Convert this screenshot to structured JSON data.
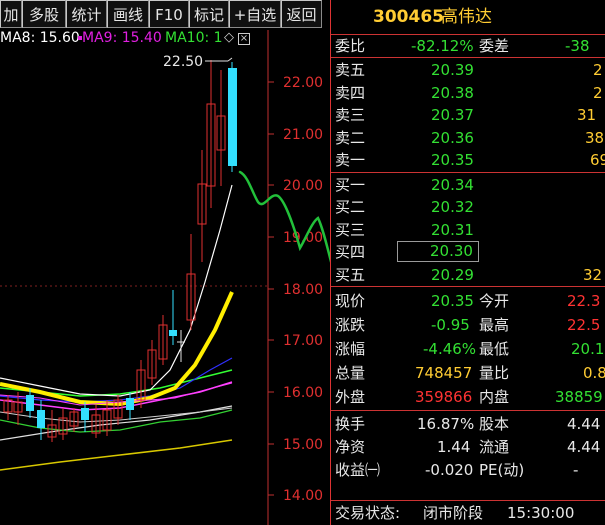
{
  "toolbar": {
    "buttons": [
      "加",
      "多股",
      "统计",
      "画线",
      "F10",
      "标记",
      "+自选",
      "返回"
    ]
  },
  "ma": {
    "ma8": "MA8: 15.60",
    "ma9": "MA9: 15.40",
    "ma10": "MA10: 1"
  },
  "chart": {
    "high_label": "22.50",
    "y_ticks": [
      "22.00",
      "21.00",
      "20.00",
      "19.00",
      "18.00",
      "17.00",
      "16.00",
      "15.00",
      "14.00"
    ]
  },
  "stock": {
    "code": "300465",
    "name": "高伟达"
  },
  "committee": {
    "ratio_label": "委比",
    "ratio_value": "-82.12%",
    "diff_label": "委差",
    "diff_value": "-38"
  },
  "asks": [
    {
      "label": "卖五",
      "price": "20.39",
      "vol": "2"
    },
    {
      "label": "卖四",
      "price": "20.38",
      "vol": "2"
    },
    {
      "label": "卖三",
      "price": "20.37",
      "vol": "31"
    },
    {
      "label": "卖二",
      "price": "20.36",
      "vol": "38"
    },
    {
      "label": "卖一",
      "price": "20.35",
      "vol": "69"
    }
  ],
  "bids": [
    {
      "label": "买一",
      "price": "20.34",
      "vol": ""
    },
    {
      "label": "买二",
      "price": "20.32",
      "vol": ""
    },
    {
      "label": "买三",
      "price": "20.31",
      "vol": ""
    },
    {
      "label": "买四",
      "price": "20.30",
      "vol": ""
    },
    {
      "label": "买五",
      "price": "20.29",
      "vol": "32"
    }
  ],
  "quote": [
    {
      "l1": "现价",
      "v1": "20.35",
      "l2": "今开",
      "v2": "22.3"
    },
    {
      "l1": "涨跌",
      "v1": "-0.95",
      "l2": "最高",
      "v2": "22.5"
    },
    {
      "l1": "涨幅",
      "v1": "-4.46%",
      "l2": "最低",
      "v2": "20.1"
    },
    {
      "l1": "总量",
      "v1": "748457",
      "l2": "量比",
      "v2": "0.8"
    },
    {
      "l1": "外盘",
      "v1": "359866",
      "l2": "内盘",
      "v2": "38859"
    }
  ],
  "fund": [
    {
      "l1": "换手",
      "v1": "16.87%",
      "l2": "股本",
      "v2": "4.44"
    },
    {
      "l1": "净资",
      "v1": "1.44",
      "l2": "流通",
      "v2": "4.44"
    },
    {
      "l1": "收益㈠",
      "v1": "-0.020",
      "l2": "PE(动)",
      "v2": "-"
    }
  ],
  "status": {
    "label": "交易状态:",
    "value": "闭市阶段",
    "time": "15:30:00"
  },
  "colors": {
    "ma8": "#ffffff",
    "ma9": "#e020e0",
    "ma10": "#33e033",
    "up": "#e03030",
    "down": "#33e0ff"
  }
}
